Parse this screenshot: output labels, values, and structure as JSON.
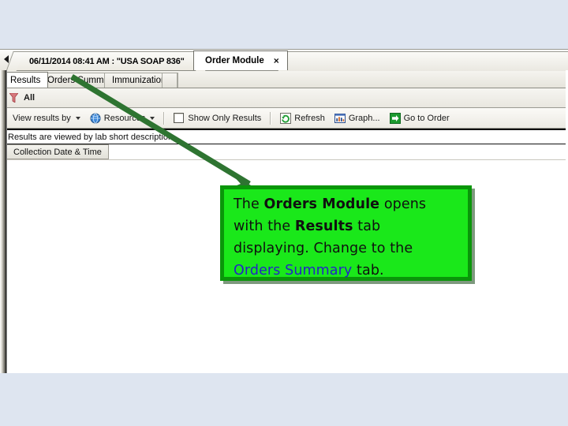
{
  "window": {
    "top_tabs": [
      {
        "label": "06/11/2014 08:41 AM : \"USA SOAP 836\"",
        "active": false
      },
      {
        "label": "Order Module",
        "active": true,
        "close": "×"
      }
    ],
    "scroll_left_icon": "triangle-left-icon"
  },
  "module_tabs": [
    {
      "label": "Results",
      "active": true
    },
    {
      "label": "Orders Summary",
      "active": false
    },
    {
      "label": "Immunizations",
      "active": false
    }
  ],
  "filter_bar": {
    "icon": "funnel-icon",
    "label": "All"
  },
  "toolbar": {
    "view_results_by": "View results by",
    "resources": "Resources",
    "show_only_results": "Show Only Results",
    "refresh": "Refresh",
    "graph": "Graph...",
    "go_to_order": "Go to Order",
    "icons": {
      "resources": "globe-icon",
      "refresh": "refresh-icon",
      "graph": "chart-icon",
      "go_to_order": "green-arrow-icon",
      "dropdown": "chevron-down-icon"
    }
  },
  "results_panel": {
    "description": "Results are viewed by lab short description.",
    "columns": [
      "Collection Date & Time"
    ],
    "rows": []
  },
  "callout": {
    "lines": [
      [
        {
          "text": "The ",
          "style": "normal"
        },
        {
          "text": "Orders Module",
          "style": "bold"
        },
        {
          "text": " opens",
          "style": "normal"
        }
      ],
      [
        {
          "text": "with the ",
          "style": "normal"
        },
        {
          "text": "Results",
          "style": "bold"
        },
        {
          "text": " tab",
          "style": "normal"
        }
      ],
      [
        {
          "text": "displaying.  Change to the",
          "style": "normal"
        }
      ],
      [
        {
          "text": "Orders Summary",
          "style": "blue"
        },
        {
          "text": " tab.",
          "style": "normal"
        }
      ]
    ],
    "fill_color": "#1AE81A",
    "border_color": "#0A960A",
    "highlight_color": "#2424C8"
  },
  "annotation_arrow": {
    "color": "#2E7431",
    "from_label": "Orders Summary",
    "to_label": "callout-box"
  },
  "page": {
    "background_color": "#DEE5F0"
  }
}
